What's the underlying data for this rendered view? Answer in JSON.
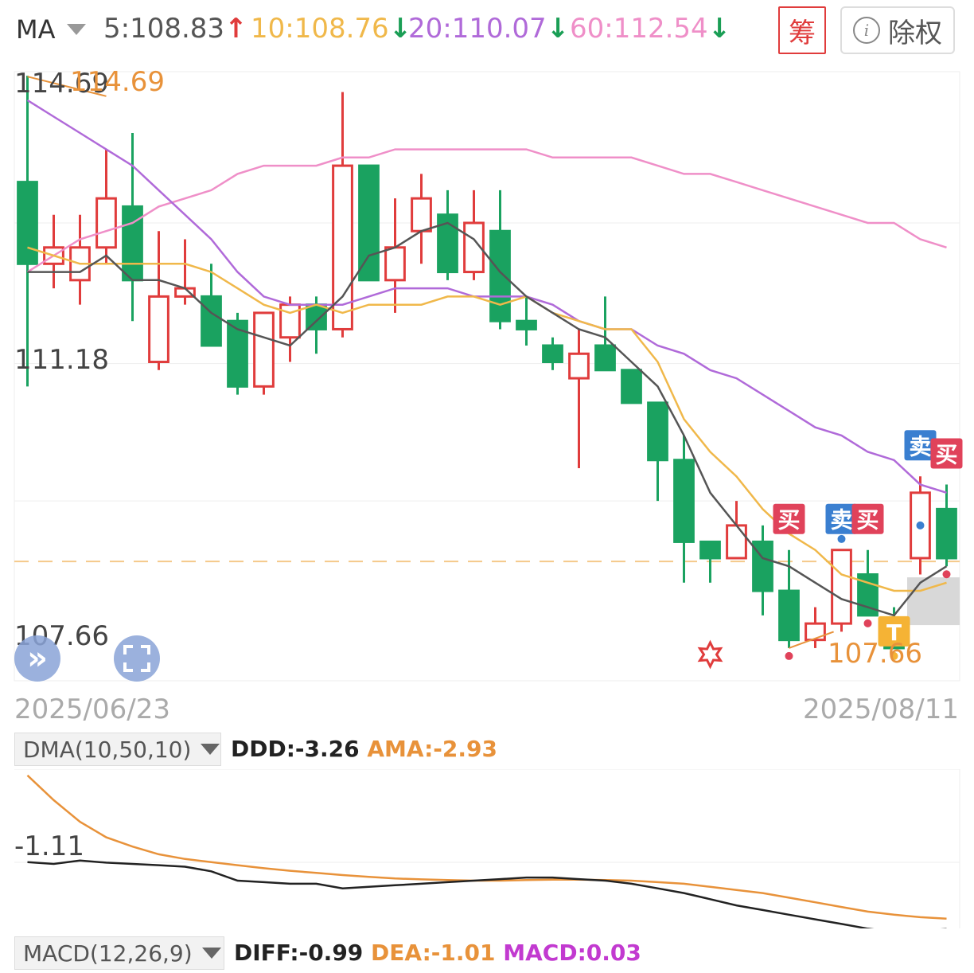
{
  "header": {
    "indicator": "MA",
    "ma": [
      {
        "label": "5:108.83",
        "color": "#555555",
        "arrow": "↑",
        "arrow_color": "#e03c3c"
      },
      {
        "label": "10:108.76",
        "color": "#f0b84a",
        "arrow": "↓",
        "arrow_color": "#1a9e55"
      },
      {
        "label": "20:110.07",
        "color": "#b06ad9",
        "arrow": "↓",
        "arrow_color": "#1a9e55"
      },
      {
        "label": "60:112.54",
        "color": "#ef8fc8",
        "arrow": "↓",
        "arrow_color": "#1a9e55"
      }
    ],
    "chou_label": "筹",
    "chuquan_label": "除权",
    "info_icon": "i"
  },
  "colors": {
    "up": "#e03c3c",
    "down": "#1aa260",
    "ma5": "#555555",
    "ma10": "#f0b84a",
    "ma20": "#b06ad9",
    "ma60": "#ef8fc8",
    "dea": "#e8923a"
  },
  "chart_data": [
    {
      "type": "candlestick",
      "y_ticks": [
        "114.69",
        "111.18",
        "107.66"
      ],
      "max_label": "114.69",
      "min_label": "107.66",
      "ylim": [
        107.66,
        114.69
      ],
      "reference_price": 108.76,
      "x_labels": [
        "2025/06/23",
        "2025/08/11"
      ],
      "candles": [
        {
          "o": 113.4,
          "h": 114.7,
          "l": 110.9,
          "c": 112.4
        },
        {
          "o": 112.4,
          "h": 113.0,
          "l": 112.1,
          "c": 112.6
        },
        {
          "o": 112.2,
          "h": 113.0,
          "l": 111.9,
          "c": 112.6
        },
        {
          "o": 112.6,
          "h": 113.8,
          "l": 112.4,
          "c": 113.2
        },
        {
          "o": 113.1,
          "h": 114.0,
          "l": 111.7,
          "c": 112.2
        },
        {
          "o": 111.2,
          "h": 112.8,
          "l": 111.1,
          "c": 112.0
        },
        {
          "o": 112.0,
          "h": 112.7,
          "l": 111.9,
          "c": 112.1
        },
        {
          "o": 112.0,
          "h": 112.4,
          "l": 111.4,
          "c": 111.4
        },
        {
          "o": 111.7,
          "h": 111.8,
          "l": 110.8,
          "c": 110.9
        },
        {
          "o": 110.9,
          "h": 111.7,
          "l": 110.8,
          "c": 111.8
        },
        {
          "o": 111.5,
          "h": 112.0,
          "l": 111.2,
          "c": 111.9
        },
        {
          "o": 111.9,
          "h": 112.0,
          "l": 111.3,
          "c": 111.6
        },
        {
          "o": 111.6,
          "h": 114.5,
          "l": 111.5,
          "c": 113.6
        },
        {
          "o": 113.6,
          "h": 113.1,
          "l": 112.2,
          "c": 112.2
        },
        {
          "o": 112.2,
          "h": 113.2,
          "l": 111.8,
          "c": 112.6
        },
        {
          "o": 112.8,
          "h": 113.5,
          "l": 112.4,
          "c": 113.2
        },
        {
          "o": 113.0,
          "h": 113.3,
          "l": 112.2,
          "c": 112.3
        },
        {
          "o": 112.3,
          "h": 113.3,
          "l": 112.2,
          "c": 112.9
        },
        {
          "o": 112.8,
          "h": 113.3,
          "l": 111.6,
          "c": 111.7
        },
        {
          "o": 111.7,
          "h": 112.0,
          "l": 111.4,
          "c": 111.6
        },
        {
          "o": 111.4,
          "h": 111.5,
          "l": 111.1,
          "c": 111.2
        },
        {
          "o": 111.0,
          "h": 111.6,
          "l": 109.9,
          "c": 111.3
        },
        {
          "o": 111.4,
          "h": 112.0,
          "l": 111.1,
          "c": 111.1
        },
        {
          "o": 111.1,
          "h": 111.0,
          "l": 110.7,
          "c": 110.7
        },
        {
          "o": 110.7,
          "h": 110.7,
          "l": 109.5,
          "c": 110.0
        },
        {
          "o": 110.0,
          "h": 110.3,
          "l": 108.5,
          "c": 109.0
        },
        {
          "o": 109.0,
          "h": 109.0,
          "l": 108.5,
          "c": 108.8
        },
        {
          "o": 108.8,
          "h": 109.5,
          "l": 108.8,
          "c": 109.2
        },
        {
          "o": 109.0,
          "h": 109.2,
          "l": 108.1,
          "c": 108.4
        },
        {
          "o": 108.4,
          "h": 108.9,
          "l": 107.7,
          "c": 107.8
        },
        {
          "o": 107.8,
          "h": 108.2,
          "l": 107.7,
          "c": 108.0
        },
        {
          "o": 108.0,
          "h": 108.9,
          "l": 107.9,
          "c": 108.9
        },
        {
          "o": 108.6,
          "h": 108.9,
          "l": 108.1,
          "c": 108.1
        },
        {
          "o": 108.0,
          "h": 108.2,
          "l": 107.7,
          "c": 107.7
        },
        {
          "o": 108.8,
          "h": 109.8,
          "l": 108.6,
          "c": 109.6
        },
        {
          "o": 109.4,
          "h": 109.7,
          "l": 108.7,
          "c": 108.8
        }
      ],
      "ma5": [
        112.3,
        112.3,
        112.3,
        112.5,
        112.2,
        112.2,
        112.1,
        111.8,
        111.6,
        111.5,
        111.4,
        111.7,
        112.0,
        112.5,
        112.6,
        112.8,
        112.9,
        112.7,
        112.3,
        112.0,
        111.8,
        111.6,
        111.5,
        111.2,
        110.9,
        110.3,
        109.6,
        109.2,
        108.8,
        108.7,
        108.5,
        108.3,
        108.2,
        108.1,
        108.5,
        108.7
      ],
      "ma10": [
        112.6,
        112.5,
        112.4,
        112.4,
        112.4,
        112.4,
        112.4,
        112.3,
        112.1,
        111.9,
        111.8,
        111.9,
        111.8,
        111.9,
        111.9,
        111.9,
        112.0,
        112.0,
        111.9,
        112.0,
        111.8,
        111.7,
        111.6,
        111.6,
        111.2,
        110.5,
        110.1,
        109.8,
        109.4,
        109.1,
        108.9,
        108.6,
        108.5,
        108.4,
        108.4,
        108.5
      ],
      "ma20": [
        114.4,
        114.2,
        114.0,
        113.8,
        113.6,
        113.3,
        113.0,
        112.7,
        112.3,
        112.0,
        111.9,
        111.9,
        111.9,
        112.0,
        112.1,
        112.1,
        112.1,
        112.0,
        112.0,
        112.0,
        111.9,
        111.7,
        111.6,
        111.6,
        111.4,
        111.3,
        111.1,
        111.0,
        110.8,
        110.6,
        110.4,
        110.3,
        110.1,
        110.0,
        109.7,
        109.6
      ],
      "ma60": [
        112.3,
        112.5,
        112.7,
        112.8,
        112.9,
        113.1,
        113.2,
        113.3,
        113.5,
        113.6,
        113.6,
        113.6,
        113.7,
        113.7,
        113.8,
        113.8,
        113.8,
        113.8,
        113.8,
        113.8,
        113.7,
        113.7,
        113.7,
        113.7,
        113.6,
        113.5,
        113.5,
        113.4,
        113.3,
        113.2,
        113.1,
        113.0,
        112.9,
        112.9,
        112.7,
        112.6
      ],
      "signals": [
        {
          "index": 29,
          "label": "买",
          "kind": "buy"
        },
        {
          "index": 31,
          "label": "卖",
          "kind": "sell"
        },
        {
          "index": 32,
          "label": "买",
          "kind": "buy"
        },
        {
          "index": 34,
          "label": "卖",
          "kind": "sell"
        },
        {
          "index": 35,
          "label": "买",
          "kind": "buy"
        },
        {
          "index": 33,
          "label": "T",
          "kind": "t"
        }
      ]
    },
    {
      "type": "line",
      "name": "DMA(10,50,10)",
      "y_tick": "-1.11",
      "series": [
        {
          "name": "DDD",
          "value_label": "DDD:-3.26",
          "values": [
            -1.1,
            -1.16,
            -1.05,
            -1.12,
            -1.16,
            -1.2,
            -1.25,
            -1.4,
            -1.7,
            -1.75,
            -1.8,
            -1.8,
            -1.95,
            -1.9,
            -1.85,
            -1.8,
            -1.75,
            -1.7,
            -1.65,
            -1.6,
            -1.6,
            -1.65,
            -1.7,
            -1.8,
            -1.95,
            -2.1,
            -2.3,
            -2.5,
            -2.65,
            -2.8,
            -2.95,
            -3.1,
            -3.25,
            -3.35,
            -3.32,
            -3.26
          ]
        },
        {
          "name": "AMA",
          "value_label": "AMA:-2.93",
          "values": [
            1.7,
            0.9,
            0.2,
            -0.3,
            -0.6,
            -0.85,
            -1.0,
            -1.1,
            -1.2,
            -1.3,
            -1.38,
            -1.45,
            -1.52,
            -1.58,
            -1.63,
            -1.66,
            -1.68,
            -1.7,
            -1.7,
            -1.68,
            -1.67,
            -1.67,
            -1.68,
            -1.7,
            -1.75,
            -1.8,
            -1.9,
            -2.0,
            -2.1,
            -2.25,
            -2.4,
            -2.55,
            -2.7,
            -2.8,
            -2.88,
            -2.93
          ]
        }
      ],
      "ylim": [
        -3.5,
        1.9
      ]
    }
  ],
  "macd": {
    "name": "MACD(12,26,9)",
    "diff": "DIFF:-0.99",
    "dea": "DEA:-1.01",
    "macd": "MACD:0.03"
  },
  "controls": {
    "expand_icon": "»",
    "fullscreen_icon": "⛶"
  }
}
